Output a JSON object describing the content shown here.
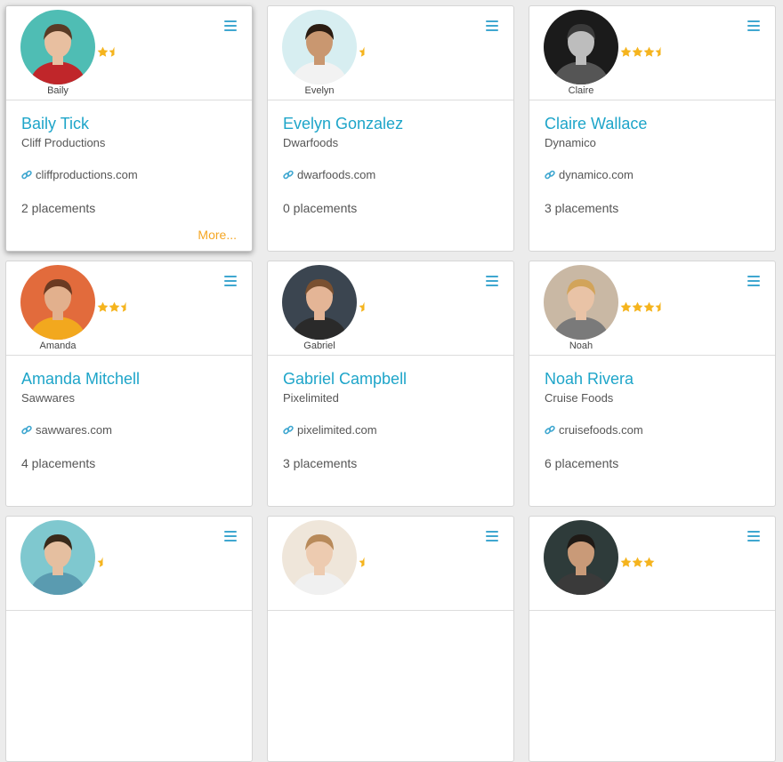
{
  "colors": {
    "accent": "#1ea5c9",
    "link": "#3fa7d0",
    "more": "#f5a623",
    "star": "#f5b41e"
  },
  "cards": [
    {
      "nickname": "Baily",
      "name": "Baily Tick",
      "company": "Cliff Productions",
      "website": "cliffproductions.com",
      "placements": "2 placements",
      "rating": 1.5,
      "more": "More...",
      "avatar_bg": "#4fbdb4",
      "skin": "#e8bfa0",
      "hair": "#5a3b25",
      "shirt": "#c0262a"
    },
    {
      "nickname": "Evelyn",
      "name": "Evelyn Gonzalez",
      "company": "Dwarfoods",
      "website": "dwarfoods.com",
      "placements": "0 placements",
      "rating": 0.5,
      "avatar_bg": "#d7eef1",
      "skin": "#c99770",
      "hair": "#2b1c12",
      "shirt": "#f2f2f2"
    },
    {
      "nickname": "Claire",
      "name": "Claire Wallace",
      "company": "Dynamico",
      "website": "dynamico.com",
      "placements": "3 placements",
      "rating": 3.5,
      "avatar_bg": "#1b1b1b",
      "skin": "#bdbdbd",
      "hair": "#3a3a3a",
      "shirt": "#555555"
    },
    {
      "nickname": "Amanda",
      "name": "Amanda Mitchell",
      "company": "Sawwares",
      "website": "sawwares.com",
      "placements": "4 placements",
      "rating": 2.5,
      "avatar_bg": "#e26b3c",
      "skin": "#e2b08d",
      "hair": "#6b3a22",
      "shirt": "#f2a81e"
    },
    {
      "nickname": "Gabriel",
      "name": "Gabriel Campbell",
      "company": "Pixelimited",
      "website": "pixelimited.com",
      "placements": "3 placements",
      "rating": 0.5,
      "avatar_bg": "#3b4550",
      "skin": "#e4b596",
      "hair": "#7a5030",
      "shirt": "#2a2a2a"
    },
    {
      "nickname": "Noah",
      "name": "Noah Rivera",
      "company": "Cruise Foods",
      "website": "cruisefoods.com",
      "placements": "6 placements",
      "rating": 3.5,
      "avatar_bg": "#c9b8a4",
      "skin": "#e9c3a6",
      "hair": "#d2a45a",
      "shirt": "#7a7a7a"
    },
    {
      "rating": 0.5,
      "avatar_bg": "#7fc8cf",
      "skin": "#e5bfa0",
      "hair": "#3a2a1a",
      "shirt": "#5a9bb0"
    },
    {
      "rating": 0.5,
      "avatar_bg": "#efe6da",
      "skin": "#edcbb0",
      "hair": "#b88a5a",
      "shirt": "#f0f0f0"
    },
    {
      "rating": 3,
      "avatar_bg": "#2e3b3a",
      "skin": "#c99a78",
      "hair": "#1f1a16",
      "shirt": "#3a3a3a"
    }
  ]
}
